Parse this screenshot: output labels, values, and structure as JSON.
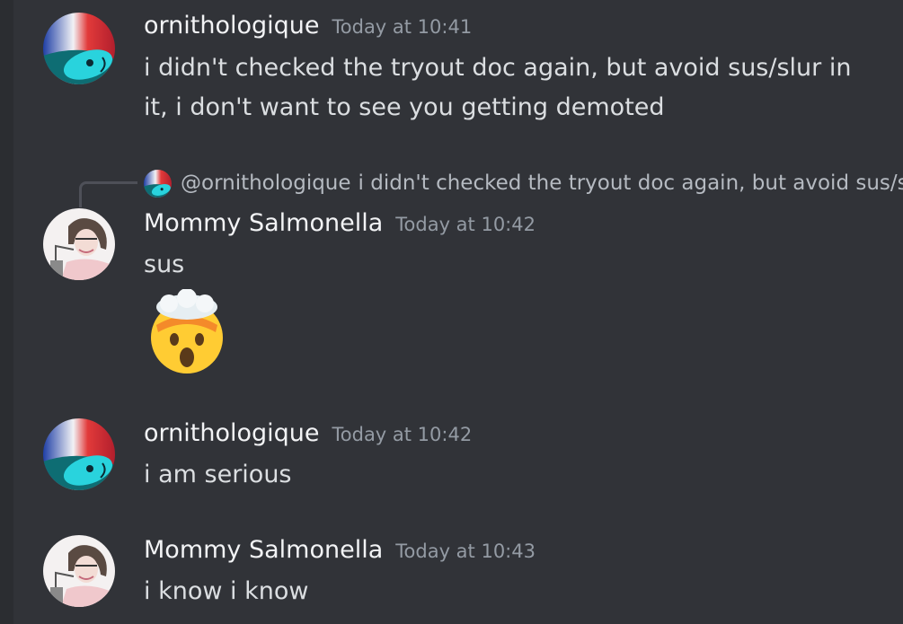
{
  "messages": [
    {
      "username": "ornithologique",
      "timestamp": "Today at 10:41",
      "lines": [
        "i didn't checked the tryout doc again, but avoid sus/slur in",
        "it, i don't want to see you getting demoted"
      ]
    },
    {
      "username": "Mommy Salmonella",
      "timestamp": "Today at 10:42",
      "reply": {
        "mention": "@ornithologique",
        "text": "i didn't checked the tryout doc again, but avoid sus/slur in it, i don't want to see you getting demoted"
      },
      "text": "sus",
      "emoji": "exploding-head"
    },
    {
      "username": "ornithologique",
      "timestamp": "Today at 10:42",
      "text": "i am serious"
    },
    {
      "username": "Mommy Salmonella",
      "timestamp": "Today at 10:43",
      "text": "i know i know"
    }
  ],
  "colors": {
    "background": "#313338",
    "username": "#f2f3f5",
    "timestamp": "#949ba4",
    "text": "#dbdee1"
  }
}
